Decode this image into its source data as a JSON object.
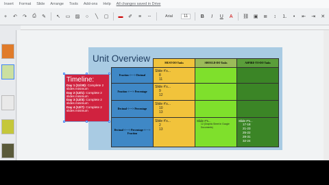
{
  "menubar": {
    "items": [
      "Insert",
      "Format",
      "Slide",
      "Arrange",
      "Tools",
      "Add-ons",
      "Help"
    ],
    "saved_text": "All changes saved in Drive"
  },
  "toolbar": {
    "font": "Arial",
    "font_size": "11",
    "bold": "B",
    "italic": "I",
    "underline": "U",
    "icons": [
      "add-icon",
      "undo-icon",
      "redo-icon",
      "print-icon",
      "paint-format-icon",
      "zoom-icon",
      "select-icon",
      "text-box-icon",
      "image-icon",
      "shape-icon",
      "line-icon",
      "comment-icon",
      "text-color-icon",
      "highlight-icon",
      "link-icon",
      "align-icon",
      "line-spacing-icon",
      "numbered-list-icon",
      "bulleted-list-icon",
      "decrease-indent-icon",
      "increase-indent-icon",
      "clear-format-icon"
    ]
  },
  "colors": {
    "slide_bg": "#a9cbe3",
    "title": "#1f3d60",
    "must_header": "#f1c33b",
    "should_header": "#9bbb59",
    "aspire_header": "#5a9e3a",
    "row_label": "#3f88c6",
    "timeline_bg": "#d0223f"
  },
  "slide": {
    "title": "Unit Overview",
    "table": {
      "headers": [
        "MUST-DO Tasks",
        "SHOULD-DO Tasks",
        "ASPIRE-TO-DO Tasks"
      ],
      "rows": [
        {
          "label": "Fraction <----> Decimal",
          "must_title": "Slide #'s...",
          "must_items": [
            "8",
            "11"
          ],
          "should_title": "",
          "should_items": [],
          "aspire_title": "",
          "aspire_items": []
        },
        {
          "label": "Fraction <----> Percentage",
          "must_title": "Slide #'s...",
          "must_items": [
            "9",
            "12"
          ],
          "should_title": "",
          "should_items": [],
          "aspire_title": "",
          "aspire_items": []
        },
        {
          "label": "Decimal <----> Percentage",
          "must_title": "Slide #'s...",
          "must_items": [
            "10",
            "13"
          ],
          "should_title": "",
          "should_items": [],
          "aspire_title": "",
          "aspire_items": []
        },
        {
          "label": "Decimal <----> Percentage <----> Fraction",
          "must_title": "Slide #'s...",
          "must_items": [
            "2",
            "13"
          ],
          "should_title": "Slide #'s...",
          "should_items": [
            "12 (Graphic Sheet in Google Documents)"
          ],
          "aspire_title": "Slide #'s...",
          "aspire_items": [
            "17-18",
            "21-23",
            "25-22",
            "28-31",
            "32-24"
          ]
        }
      ]
    },
    "timeline": {
      "title": "Timeline:",
      "rows": [
        {
          "day": "Day 1 (11/30):",
          "text": "Complete 2 slides minimum"
        },
        {
          "day": "Day 2 (12/1):",
          "text": "Complete 2 slides minimum"
        },
        {
          "day": "Day 3 (12/3):",
          "text": "Complete 2 slides minimum"
        },
        {
          "day": "Day 4 (12/7):",
          "text": "Complete 2 slides minimum"
        }
      ]
    }
  }
}
